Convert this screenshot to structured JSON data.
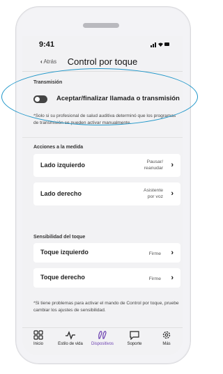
{
  "status": {
    "time": "9:41"
  },
  "nav": {
    "back_label": "Atrás",
    "title": "Control por toque"
  },
  "transmission": {
    "section_label": "Transmisión",
    "toggle_label": "Aceptar/finalizar llamada o transmisión",
    "toggle_on": false,
    "note": "*Solo si su profesional de salud auditiva determinó que los programas de transmisión se pueden activar manualmente."
  },
  "custom_actions": {
    "section_label": "Acciones a la medida",
    "items": [
      {
        "label": "Lado izquierdo",
        "value_line1": "Pausar/",
        "value_line2": "reanudar"
      },
      {
        "label": "Lado derecho",
        "value_line1": "Asistente",
        "value_line2": "por voz"
      }
    ]
  },
  "sensitivity": {
    "section_label": "Sensibilidad del toque",
    "items": [
      {
        "label": "Toque izquierdo",
        "value": "Firme"
      },
      {
        "label": "Toque derecho",
        "value": "Firme"
      }
    ],
    "note": "*Si tiene problemas para activar el mando de Control por toque, pruebe cambiar los ajustes de sensibilidad."
  },
  "tabbar": {
    "tabs": [
      {
        "label": "Inicio",
        "icon": "grid-icon"
      },
      {
        "label": "Estilo de vida",
        "icon": "pulse-icon"
      },
      {
        "label": "Dispositivos",
        "icon": "hearing-aids-icon"
      },
      {
        "label": "Soporte",
        "icon": "chat-icon"
      },
      {
        "label": "Más",
        "icon": "gear-icon"
      }
    ],
    "active_tab": "Dispositivos"
  },
  "colors": {
    "accent": "#6b3fb0",
    "highlight_ring": "#1e96c9",
    "toggle_off": "#444444"
  }
}
